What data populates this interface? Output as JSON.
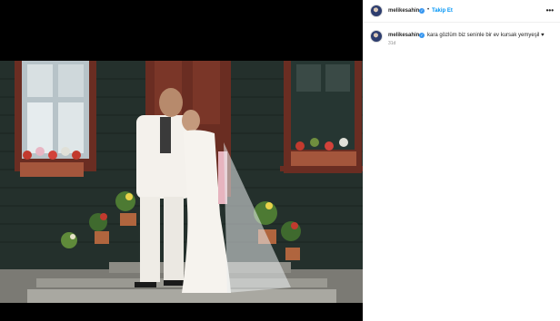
{
  "post": {
    "username": "melikesahin",
    "verified_badge": "✓",
    "separator": "•",
    "follow_label": "Takip Et",
    "more_icon": "•••",
    "caption": "kara gözlüm biz seninle bir ev kursak yemyeşil ♥",
    "timestamp": "31d"
  },
  "colors": {
    "accent": "#0095f6",
    "verified": "#3897f0",
    "text": "#262626",
    "muted": "#8e8e8e"
  }
}
